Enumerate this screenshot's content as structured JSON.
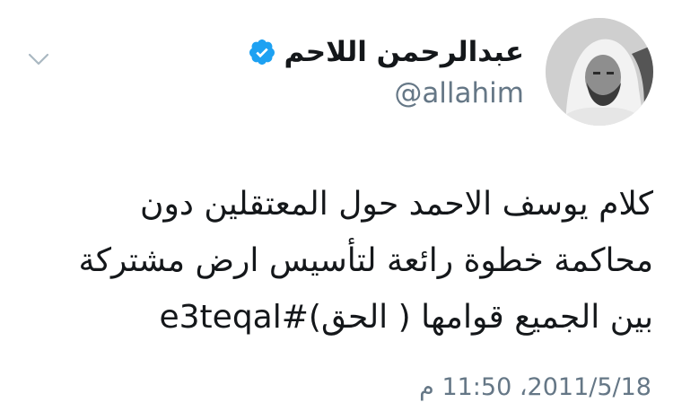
{
  "author": {
    "display_name": "عبدالرحمن اللاحم",
    "handle": "@allahim",
    "verified": true,
    "avatar_icon": "user-photo-avatar",
    "verified_icon": "verified-badge-icon",
    "verified_color": "#1da1f2"
  },
  "menu": {
    "icon": "chevron-down-icon"
  },
  "tweet": {
    "line1": "كلام يوسف الاحمد حول المعتقلين دون",
    "line2": "محاكمة خطوة رائعة لتأسيس ارض مشتركة",
    "line3": "بين الجميع قوامها ( الحق)",
    "hashtag": "#e3teqal",
    "timestamp": "2011/5/18، 11:50 م"
  }
}
